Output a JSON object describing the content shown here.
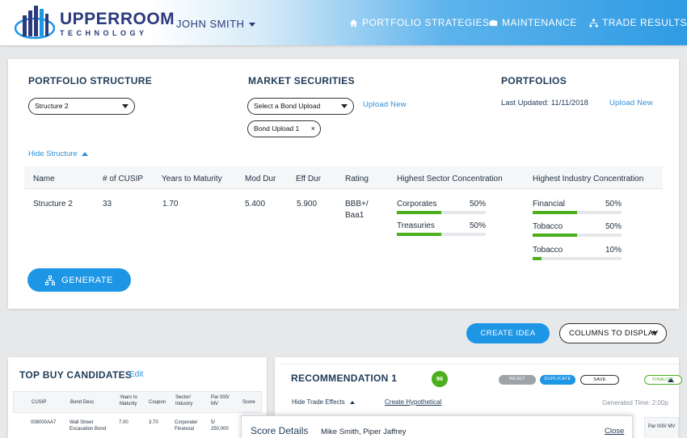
{
  "header": {
    "brand": "UPPERROOM",
    "brand_sub": "TECHNOLOGY",
    "user_name": "JOHN SMITH",
    "nav": [
      {
        "label": "PORTFOLIO STRATEGIES",
        "icon": "home-icon"
      },
      {
        "label": "MAINTENANCE",
        "icon": "briefcase-icon"
      },
      {
        "label": "TRADE RESULTS",
        "icon": "hierarchy-icon"
      }
    ]
  },
  "structure_panel": {
    "portfolio_structure": {
      "title": "PORTFOLIO STRUCTURE",
      "selected": "Structure 2"
    },
    "market_securities": {
      "title": "MARKET SECURITIES",
      "select_placeholder": "Select a Bond Upload",
      "upload_new": "Upload New",
      "chip": "Bond Upload 1",
      "chip_remove": "×"
    },
    "portfolios": {
      "title": "PORTFOLIOS",
      "last_updated": "Last Updated: 11/11/2018",
      "upload_new": "Upload New"
    },
    "hide_structure": "Hide Structure",
    "table": {
      "headers": [
        "Name",
        "# of CUSIP",
        "Years to Maturity",
        "Mod Dur",
        "Eff Dur",
        "Rating",
        "Highest Sector Concentration",
        "Highest Industry Concentration"
      ],
      "row": {
        "name": "Structure 2",
        "cusip": "33",
        "ytm": "1.70",
        "mod_dur": "5.400",
        "eff_dur": "5.900",
        "rating_1": "BBB+/",
        "rating_2": "Baa1",
        "sectors": [
          {
            "label": "Corporates",
            "pct_text": "50%",
            "pct": 0.5
          },
          {
            "label": "Treasuries",
            "pct_text": "50%",
            "pct": 0.5
          }
        ],
        "industries": [
          {
            "label": "Financial",
            "pct_text": "50%",
            "pct": 0.5
          },
          {
            "label": "Tobacco",
            "pct_text": "50%",
            "pct": 0.5
          },
          {
            "label": "Tobacco",
            "pct_text": "10%",
            "pct": 0.1
          }
        ]
      }
    },
    "generate_label": "GENERATE"
  },
  "actions": {
    "create_idea": "CREATE IDEA",
    "columns_to_display": "COLUMNS TO DISPLAY"
  },
  "top_buy": {
    "title": "TOP BUY CANDIDATES",
    "edit": "Edit",
    "headers": [
      "CUSIP",
      "Bond Desc",
      "Years to Maturity",
      "Coupon",
      "Sector/ Industry",
      "Par 000/ MV",
      "Score"
    ],
    "row": {
      "cusip": "008000AA7",
      "desc": "Wall Street Escavation Bond",
      "ytm": "7.00",
      "coupon": "3.70",
      "sector": "Corporate/ Financial",
      "par": "5/ 250,000"
    }
  },
  "recommendation": {
    "title": "RECOMMENDATION 1",
    "score": "96",
    "reset": "RESET",
    "duplicate": "DUPLICATE",
    "save": "SAVE",
    "finalize": "FINALIZE",
    "hide_trade_effects": "Hide Trade Effects",
    "create_hypothetical": "Create Hypothetical",
    "generated_time": "Generated Time: 2:00p",
    "col_header": "Par 000/ MV"
  },
  "score_details": {
    "title": "Score Details",
    "names": "Mike Smith, Piper Jaffrey",
    "close": "Close"
  },
  "colors": {
    "accent": "#1e96e6",
    "positive": "#4caf1c",
    "navy": "#2a3a7c"
  }
}
